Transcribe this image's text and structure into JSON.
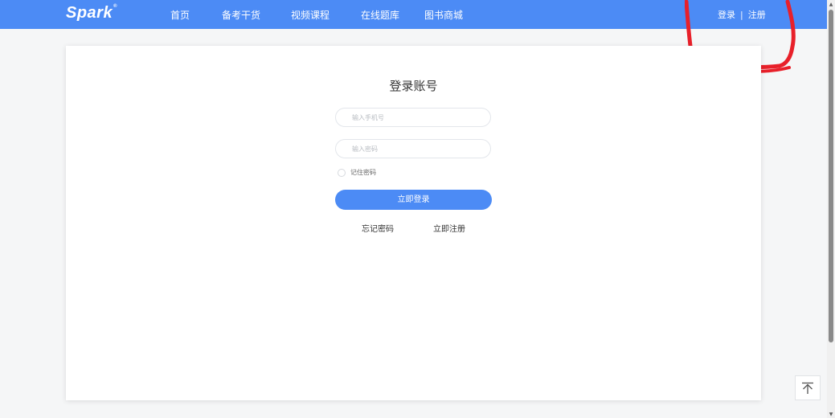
{
  "navbar": {
    "logo": "Spark",
    "logo_mark": "®",
    "items": [
      {
        "label": "首页"
      },
      {
        "label": "备考干货"
      },
      {
        "label": "视频课程"
      },
      {
        "label": "在线题库"
      },
      {
        "label": "图书商城"
      }
    ],
    "auth": {
      "login": "登录",
      "separator": "|",
      "register": "注册"
    }
  },
  "login_form": {
    "title": "登录账号",
    "phone_placeholder": "输入手机号",
    "password_placeholder": "输入密码",
    "remember_label": "记住密码",
    "submit_label": "立即登录",
    "forgot_label": "忘记密码",
    "register_label": "立即注册"
  },
  "colors": {
    "accent": "#4c8bf5",
    "annotation": "#e8202a"
  },
  "icons": {
    "back_to_top": "arrow-up-to-line-icon"
  }
}
